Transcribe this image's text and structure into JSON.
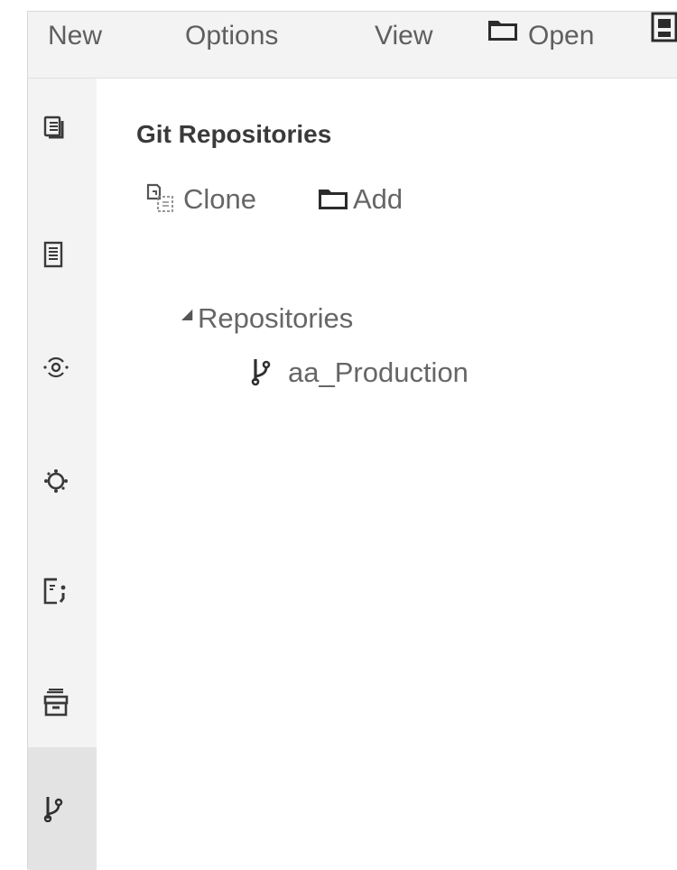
{
  "menubar": {
    "items": [
      {
        "label": "New",
        "icon": null
      },
      {
        "label": "Options",
        "icon": null
      },
      {
        "label": "View",
        "icon": null
      },
      {
        "label": "Open",
        "icon": "folder-icon"
      },
      {
        "label": "",
        "icon": "save-icon"
      }
    ]
  },
  "sidebar": {
    "items": [
      {
        "icon": "files-icon"
      },
      {
        "icon": "document-icon"
      },
      {
        "icon": "radio-signal-icon"
      },
      {
        "icon": "gear-icon"
      },
      {
        "icon": "code-snippet-icon"
      },
      {
        "icon": "archive-icon"
      },
      {
        "icon": "git-branch-icon",
        "active": true
      }
    ]
  },
  "panel": {
    "title": "Git Repositories",
    "actions": [
      {
        "label": "Clone",
        "icon": "clone-icon"
      },
      {
        "label": "Add",
        "icon": "folder-icon"
      }
    ],
    "tree": {
      "root_label": "Repositories",
      "root_expanded": true,
      "children": [
        {
          "label": "aa_Production",
          "icon": "git-branch-icon"
        }
      ]
    }
  }
}
